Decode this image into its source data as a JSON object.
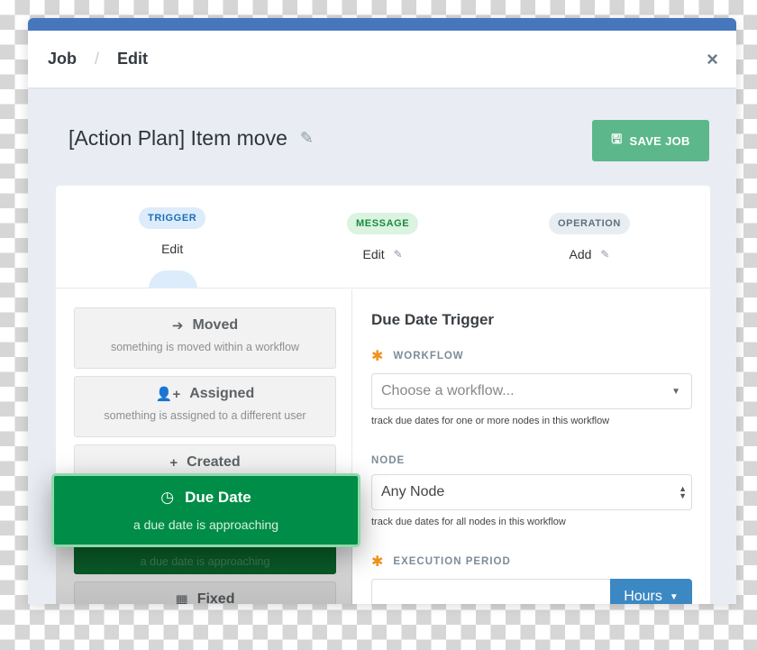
{
  "header": {
    "breadcrumb": [
      "Job",
      "Edit"
    ],
    "breadcrumb_separator": "/",
    "close_icon": "×"
  },
  "title": {
    "text": "[Action Plan] Item move",
    "edit_icon": "✎"
  },
  "toolbar": {
    "save_label": "SAVE JOB",
    "save_icon": "🖫"
  },
  "steps": [
    {
      "badge": "TRIGGER",
      "label": "Edit",
      "active": true
    },
    {
      "badge": "MESSAGE",
      "label": "Edit",
      "edit_icon": "✎"
    },
    {
      "badge": "OPERATION",
      "label": "Add",
      "edit_icon": "✎"
    }
  ],
  "trigger_options": [
    {
      "icon": "➔",
      "title": "Moved",
      "description": "something is moved within a workflow"
    },
    {
      "icon": "👤+",
      "title": "Assigned",
      "description": "something is assigned to a different user"
    },
    {
      "icon": "+",
      "title": "Created",
      "description": ""
    },
    {
      "icon": "◷",
      "title": "Due Date",
      "description": "a due date is approaching",
      "selected": true
    },
    {
      "icon": "▦",
      "title": "Fixed",
      "description": ""
    }
  ],
  "dragging_card": {
    "icon": "◷",
    "title": "Due Date",
    "description": "a due date is approaching"
  },
  "panel": {
    "title": "Due Date Trigger",
    "required_marker": "✱",
    "workflow": {
      "label": "WORKFLOW",
      "placeholder": "Choose a workflow...",
      "help": "track due dates for one or more nodes in this workflow"
    },
    "node": {
      "label": "NODE",
      "value": "Any Node",
      "help": "track due dates for all nodes in this workflow"
    },
    "execution_period": {
      "label": "EXECUTION PERIOD",
      "value": "",
      "unit": "Hours",
      "caret": "▼"
    }
  },
  "colors": {
    "accent_blue": "#4677bd",
    "save_green": "#5cb88a",
    "selected_green": "#008d47",
    "required_orange": "#f0921b",
    "hours_blue": "#3b88c3"
  }
}
